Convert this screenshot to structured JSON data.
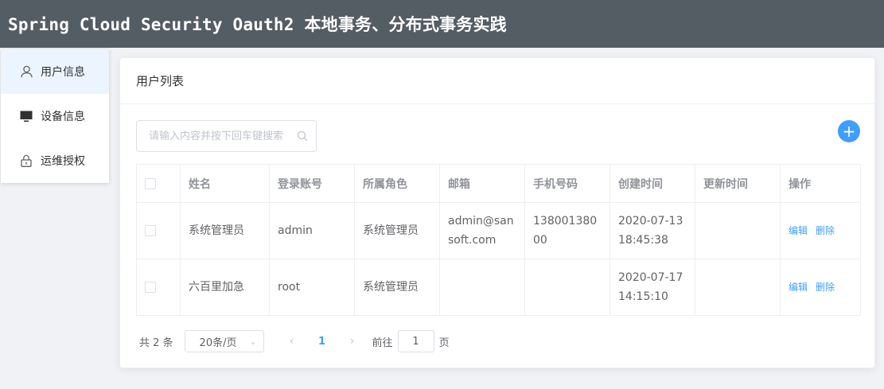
{
  "header": {
    "title": "Spring Cloud Security Oauth2 本地事务、分布式事务实践"
  },
  "colors": {
    "header_bg": "#545c64",
    "accent": "#409eff",
    "active_menu_bg": "#ecf5ff"
  },
  "sidebar": {
    "items": [
      {
        "label": "用户信息",
        "icon": "user-icon",
        "active": true
      },
      {
        "label": "设备信息",
        "icon": "monitor-icon",
        "active": false
      },
      {
        "label": "运维授权",
        "icon": "lock-icon",
        "active": false
      }
    ]
  },
  "card": {
    "title": "用户列表"
  },
  "search": {
    "placeholder": "请输入内容并按下回车键搜索",
    "value": ""
  },
  "add_button": {
    "label": "+"
  },
  "table": {
    "columns": [
      "",
      "姓名",
      "登录账号",
      "所属角色",
      "邮箱",
      "手机号码",
      "创建时间",
      "更新时间",
      "操作"
    ],
    "rows": [
      {
        "name": "系统管理员",
        "account": "admin",
        "role": "系统管理员",
        "email": "admin@sansoft.com",
        "phone": "13800138000",
        "created": "2020-07-13 18:45:38",
        "updated": "",
        "edit": "编辑",
        "delete": "删除"
      },
      {
        "name": "六百里加急",
        "account": "root",
        "role": "系统管理员",
        "email": "",
        "phone": "",
        "created": "2020-07-17 14:15:10",
        "updated": "",
        "edit": "编辑",
        "delete": "删除"
      }
    ]
  },
  "pagination": {
    "total_text": "共 2 条",
    "page_size": "20条/页",
    "prev": "‹",
    "current_page": "1",
    "next": "›",
    "goto_label": "前往",
    "goto_value": "1",
    "page_suffix": "页"
  }
}
